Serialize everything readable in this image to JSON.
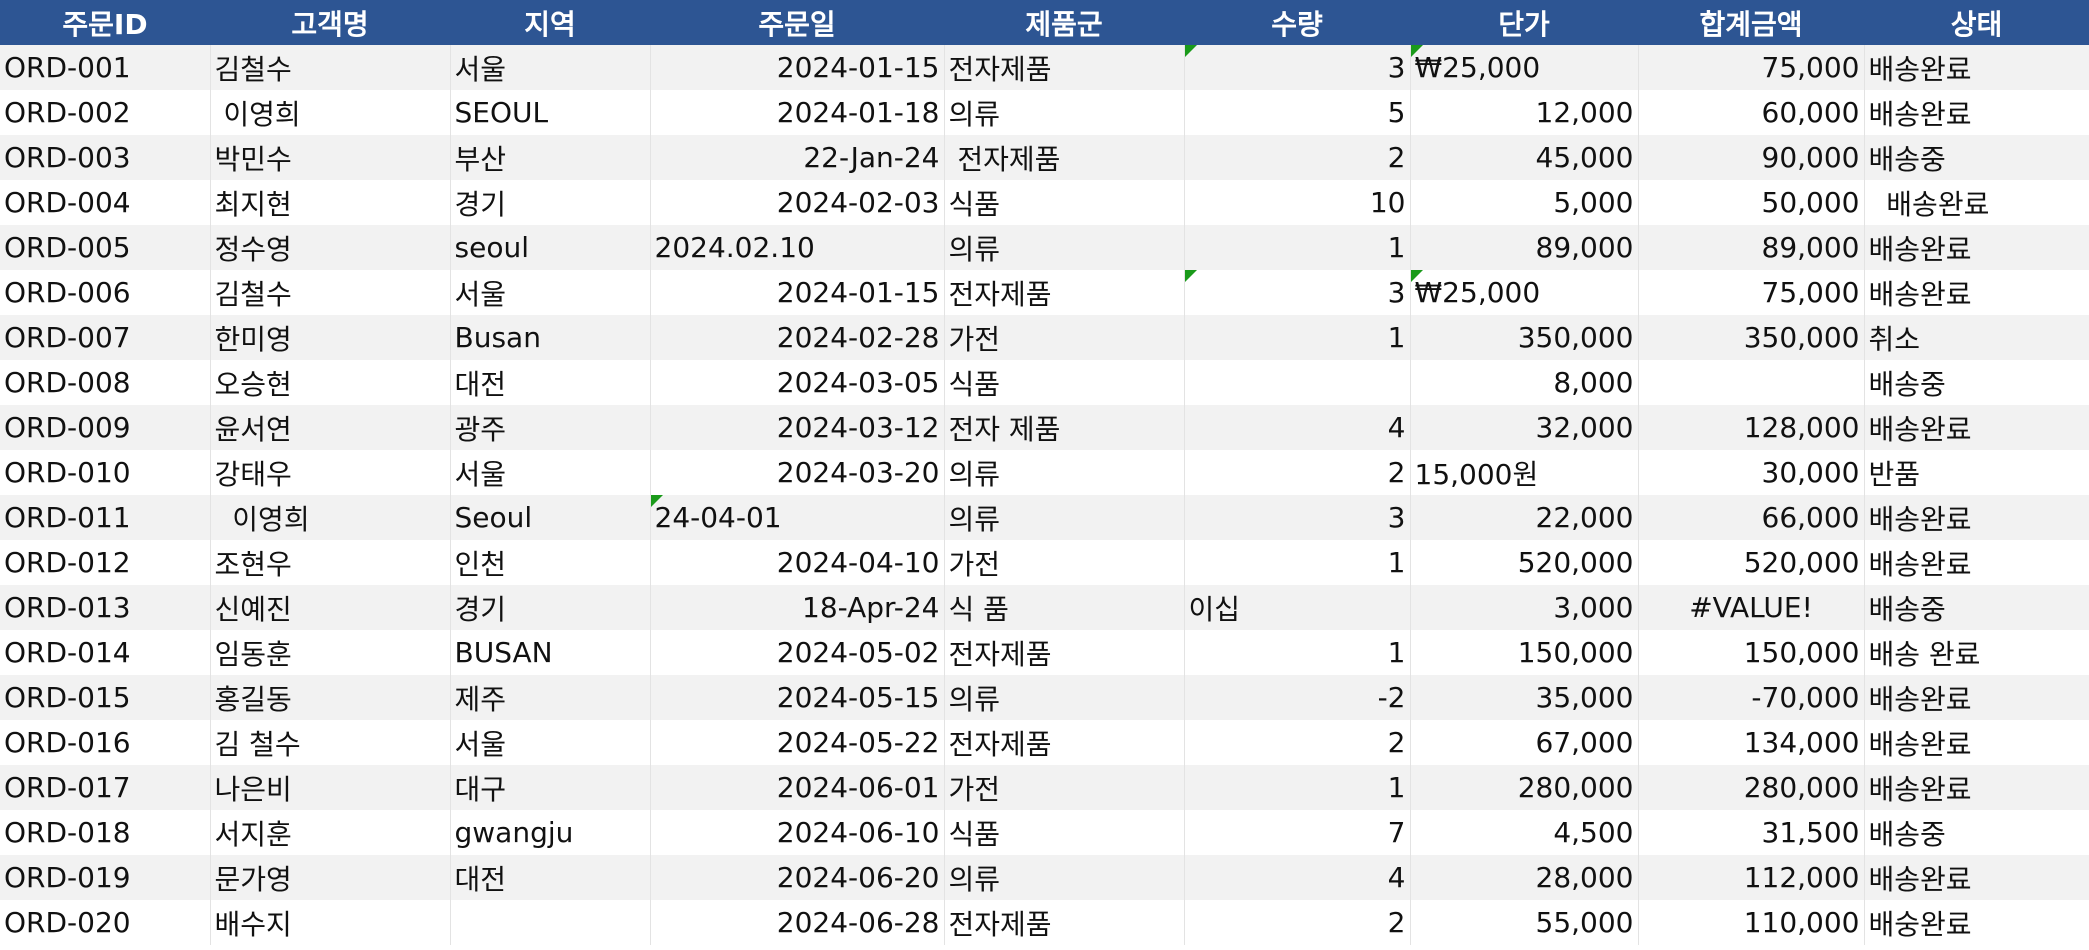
{
  "columns": [
    "주문ID",
    "고객명",
    "지역",
    "주문일",
    "제품군",
    "수량",
    "단가",
    "합계금액",
    "상태"
  ],
  "rows": [
    {
      "id": "ORD-001",
      "name": "김철수",
      "region": "서울",
      "date": "2024-01-15",
      "category": "전자제품",
      "qty": "3",
      "price": "₩25,000",
      "total": "75,000",
      "status": "배송완료",
      "date_align": "right",
      "price_align": "left",
      "qty_flag": true
    },
    {
      "id": "ORD-002",
      "name": " 이영희",
      "region": "SEOUL",
      "date": "2024-01-18",
      "category": "의류",
      "qty": "5",
      "price": "12,000",
      "total": "60,000",
      "status": "배송완료"
    },
    {
      "id": "ORD-003",
      "name": "박민수",
      "region": "부산",
      "date": "22-Jan-24",
      "category": " 전자제품",
      "qty": "2",
      "price": "45,000",
      "total": "90,000",
      "status": "배송중"
    },
    {
      "id": "ORD-004",
      "name": "최지현",
      "region": "경기",
      "date": "2024-02-03",
      "category": "식품",
      "qty": "10",
      "price": "5,000",
      "total": "50,000",
      "status": "  배송완료"
    },
    {
      "id": "ORD-005",
      "name": "정수영",
      "region": "seoul",
      "date": "2024.02.10",
      "category": "의류",
      "qty": "1",
      "price": "89,000",
      "total": "89,000",
      "status": "배송완료",
      "date_align": "left"
    },
    {
      "id": "ORD-006",
      "name": "김철수",
      "region": "서울",
      "date": "2024-01-15",
      "category": "전자제품",
      "qty": "3",
      "price": "₩25,000",
      "total": "75,000",
      "status": "배송완료",
      "price_align": "left",
      "qty_flag": true
    },
    {
      "id": "ORD-007",
      "name": "한미영",
      "region": "Busan",
      "date": "2024-02-28",
      "category": "가전",
      "qty": "1",
      "price": "350,000",
      "total": "350,000",
      "status": "취소"
    },
    {
      "id": "ORD-008",
      "name": "오승현",
      "region": "대전",
      "date": "2024-03-05",
      "category": "식품",
      "qty": "",
      "price": "8,000",
      "total": "",
      "status": "배송중"
    },
    {
      "id": "ORD-009",
      "name": "윤서연",
      "region": "광주",
      "date": "2024-03-12",
      "category": "전자 제품",
      "qty": "4",
      "price": "32,000",
      "total": "128,000",
      "status": "배송완료"
    },
    {
      "id": "ORD-010",
      "name": "강태우",
      "region": "서울",
      "date": "2024-03-20",
      "category": "의류",
      "qty": "2",
      "price": "15,000원",
      "total": "30,000",
      "status": "반품",
      "price_align": "left"
    },
    {
      "id": "ORD-011",
      "name": "  이영희",
      "region": "Seoul",
      "date": "24-04-01",
      "category": "의류",
      "qty": "3",
      "price": "22,000",
      "total": "66,000",
      "status": "배송완료",
      "date_align": "left",
      "date_flag": true
    },
    {
      "id": "ORD-012",
      "name": "조현우",
      "region": "인천",
      "date": "2024-04-10",
      "category": "가전",
      "qty": "1",
      "price": "520,000",
      "total": "520,000",
      "status": "배송완료"
    },
    {
      "id": "ORD-013",
      "name": "신예진",
      "region": "경기",
      "date": "18-Apr-24",
      "category": "식 품",
      "qty": "이십",
      "price": "3,000",
      "total": "#VALUE!",
      "status": "배송중",
      "qty_align": "left",
      "total_align": "center"
    },
    {
      "id": "ORD-014",
      "name": "임동훈",
      "region": "BUSAN",
      "date": "2024-05-02",
      "category": "전자제품",
      "qty": "1",
      "price": "150,000",
      "total": "150,000",
      "status": "배송 완료"
    },
    {
      "id": "ORD-015",
      "name": "홍길동",
      "region": "제주",
      "date": "2024-05-15",
      "category": "의류",
      "qty": "-2",
      "price": "35,000",
      "total": "-70,000",
      "status": "배송완료"
    },
    {
      "id": "ORD-016",
      "name": "김 철수",
      "region": "서울",
      "date": "2024-05-22",
      "category": "전자제품",
      "qty": "2",
      "price": "67,000",
      "total": "134,000",
      "status": "배송완료"
    },
    {
      "id": "ORD-017",
      "name": "나은비",
      "region": "대구",
      "date": "2024-06-01",
      "category": "가전",
      "qty": "1",
      "price": "280,000",
      "total": "280,000",
      "status": "배송완료"
    },
    {
      "id": "ORD-018",
      "name": "서지훈",
      "region": "gwangju",
      "date": "2024-06-10",
      "category": "식품",
      "qty": "7",
      "price": "4,500",
      "total": "31,500",
      "status": "배송중"
    },
    {
      "id": "ORD-019",
      "name": "문가영",
      "region": "대전",
      "date": "2024-06-20",
      "category": "의류",
      "qty": "4",
      "price": "28,000",
      "total": "112,000",
      "status": "배송완료"
    },
    {
      "id": "ORD-020",
      "name": "배수지",
      "region": "",
      "date": "2024-06-28",
      "category": "전자제품",
      "qty": "2",
      "price": "55,000",
      "total": "110,000",
      "status": "배숭완료"
    }
  ],
  "colors": {
    "header_bg": "#2d5593",
    "header_text": "#ffffff",
    "band": "#f2f2f2",
    "flag": "#1a9a1a"
  }
}
